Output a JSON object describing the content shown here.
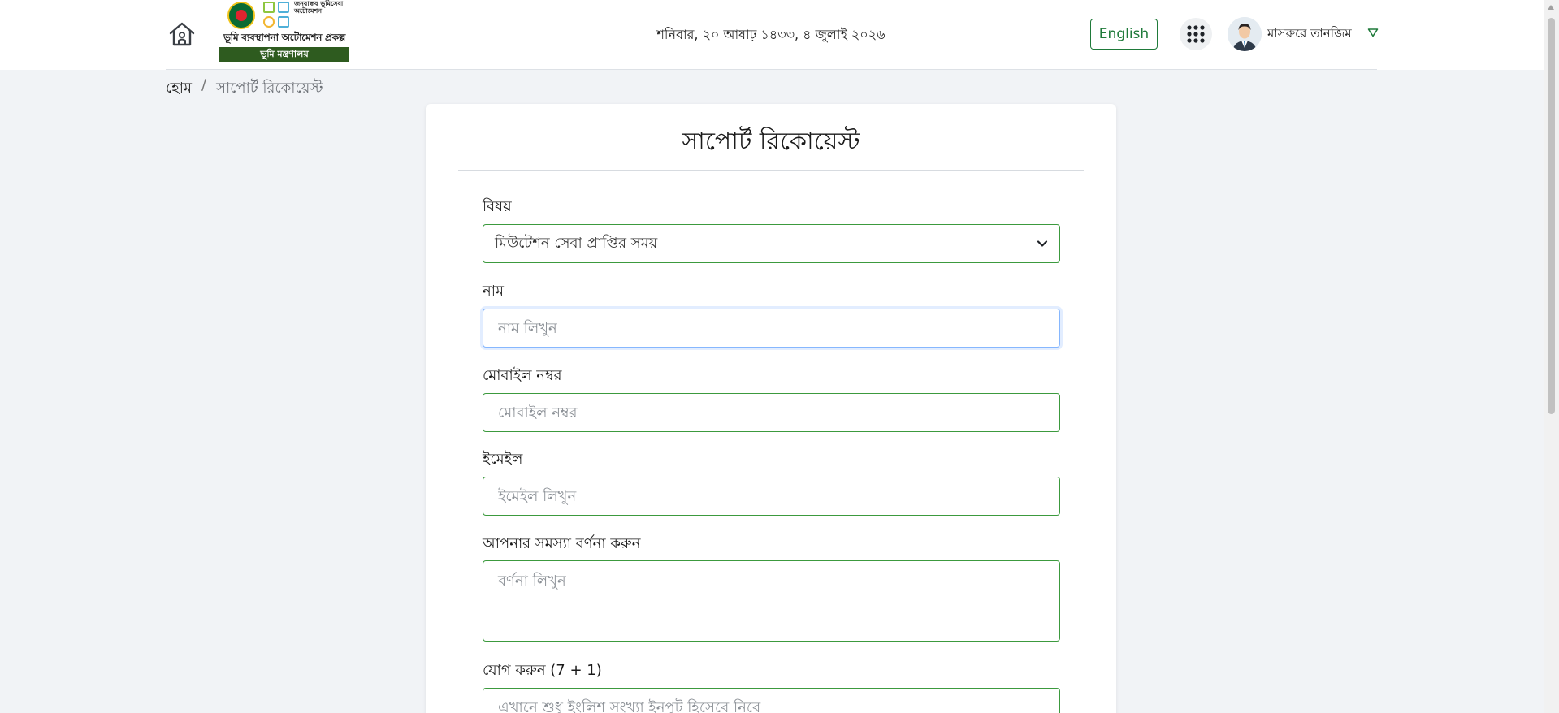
{
  "header": {
    "logo": {
      "tagline": "জনবান্ধব ভূমিসেবা অটোমেশন",
      "title": "ভূমি ব্যবস্থাপনা অটোমেশন প্রকল্প",
      "ministry": "ভূমি মন্ত্রণালয়"
    },
    "date": "শনিবার, ২০ আষাঢ় ১৪৩৩, ৪ জুলাই ২০২৬",
    "language_button": "English",
    "user_name": "মাসরুরে তানজিম",
    "icons": [
      "home-icon",
      "apps-grid-icon",
      "avatar",
      "caret-down-icon"
    ],
    "colors": {
      "accent": "#1f7a3a",
      "field_border": "#3c9a3e",
      "ministry_band": "#2e5b1f"
    }
  },
  "breadcrumb": {
    "home": "হোম",
    "separator": "/",
    "current": "সাপোর্ট রিকোয়েস্ট"
  },
  "form": {
    "title": "সাপোর্ট রিকোয়েস্ট",
    "subject": {
      "label": "বিষয়",
      "selected": "মিউটেশন সেবা প্রাপ্তির সময়"
    },
    "name": {
      "label": "নাম",
      "value": "",
      "placeholder": "নাম লিখুন"
    },
    "mobile": {
      "label": "মোবাইল নম্বর",
      "value": "",
      "placeholder": "মোবাইল নম্বর"
    },
    "email": {
      "label": "ইমেইল",
      "value": "",
      "placeholder": "ইমেইল লিখুন"
    },
    "description": {
      "label": "আপনার সমস্যা বর্ণনা করুন",
      "value": "",
      "placeholder": "বর্ণনা লিখুন"
    },
    "captcha": {
      "label": "যোগ করুন (7 + 1)",
      "value": "",
      "placeholder": "এখানে শুধু ইংলিশ সংখ্যা ইনপুট হিসেবে নিবে"
    }
  }
}
